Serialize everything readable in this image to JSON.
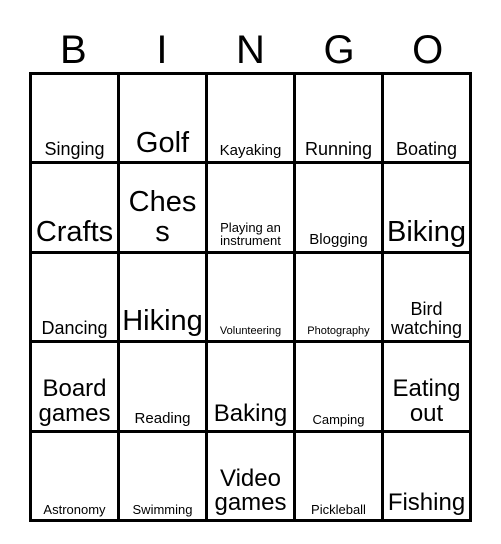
{
  "card": {
    "title": "BINGO",
    "header_letters": [
      "B",
      "I",
      "N",
      "G",
      "O"
    ],
    "rows": [
      [
        {
          "label": "Singing",
          "size": "fs-md"
        },
        {
          "label": "Golf",
          "size": "fs-xl"
        },
        {
          "label": "Kayaking",
          "size": "fs-sm"
        },
        {
          "label": "Running",
          "size": "fs-md"
        },
        {
          "label": "Boating",
          "size": "fs-md"
        }
      ],
      [
        {
          "label": "Crafts",
          "size": "fs-xl"
        },
        {
          "label": "Chess",
          "size": "fs-xl"
        },
        {
          "label": "Playing an instrument",
          "size": "fs-xs"
        },
        {
          "label": "Blogging",
          "size": "fs-sm"
        },
        {
          "label": "Biking",
          "size": "fs-xl"
        }
      ],
      [
        {
          "label": "Dancing",
          "size": "fs-md"
        },
        {
          "label": "Hiking",
          "size": "fs-xl"
        },
        {
          "label": "Volunteering",
          "size": "fs-xxs"
        },
        {
          "label": "Photography",
          "size": "fs-xxs"
        },
        {
          "label": "Bird watching",
          "size": "fs-md"
        }
      ],
      [
        {
          "label": "Board games",
          "size": "fs-lg"
        },
        {
          "label": "Reading",
          "size": "fs-sm"
        },
        {
          "label": "Baking",
          "size": "fs-lg"
        },
        {
          "label": "Camping",
          "size": "fs-xs"
        },
        {
          "label": "Eating out",
          "size": "fs-lg"
        }
      ],
      [
        {
          "label": "Astronomy",
          "size": "fs-xs"
        },
        {
          "label": "Swimming",
          "size": "fs-xs"
        },
        {
          "label": "Video games",
          "size": "fs-lg"
        },
        {
          "label": "Pickleball",
          "size": "fs-xs"
        },
        {
          "label": "Fishing",
          "size": "fs-lg"
        }
      ]
    ]
  },
  "colors": {
    "background": "#ffffff",
    "border": "#000000",
    "text": "#000000"
  }
}
